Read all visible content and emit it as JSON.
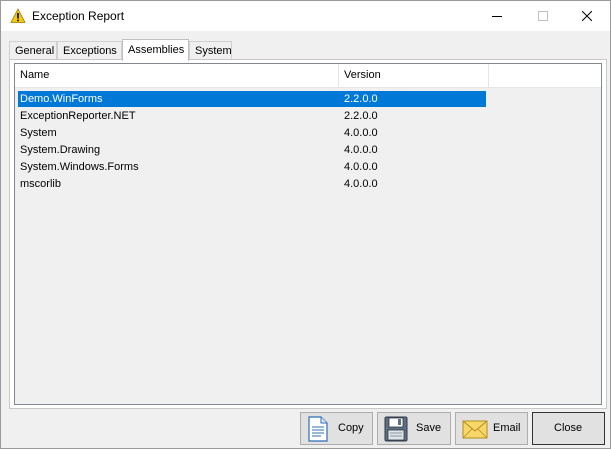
{
  "window": {
    "title": "Exception Report"
  },
  "tabs": [
    {
      "label": "General"
    },
    {
      "label": "Exceptions"
    },
    {
      "label": "Assemblies"
    },
    {
      "label": "System"
    }
  ],
  "active_tab": "Assemblies",
  "assemblies": {
    "columns": [
      "Name",
      "Version"
    ],
    "rows": [
      {
        "name": "Demo.WinForms",
        "version": "2.2.0.0"
      },
      {
        "name": "ExceptionReporter.NET",
        "version": "2.2.0.0"
      },
      {
        "name": "System",
        "version": "4.0.0.0"
      },
      {
        "name": "System.Drawing",
        "version": "4.0.0.0"
      },
      {
        "name": "System.Windows.Forms",
        "version": "4.0.0.0"
      },
      {
        "name": "mscorlib",
        "version": "4.0.0.0"
      }
    ],
    "selected_index": 0
  },
  "buttons": {
    "copy": "Copy",
    "save": "Save",
    "email": "Email",
    "close": "Close"
  },
  "icons": {
    "title": "warning-icon",
    "copy": "document-icon",
    "save": "floppy-disk-icon",
    "email": "envelope-icon"
  },
  "colors": {
    "selection": "#0078d7",
    "warning": "#f2c811"
  }
}
